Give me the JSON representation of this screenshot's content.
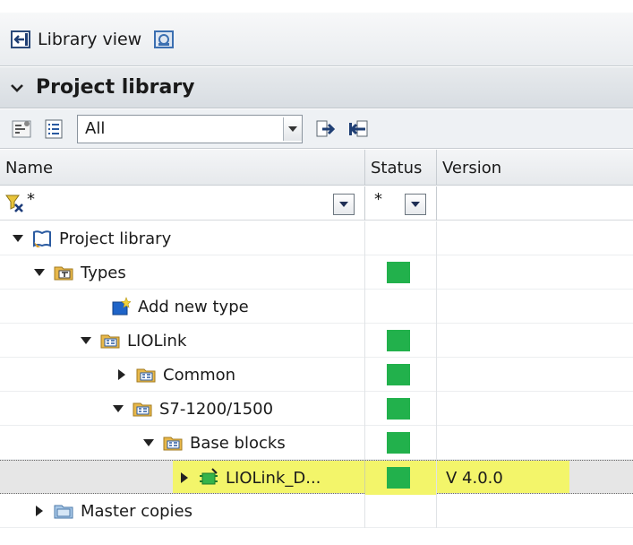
{
  "toolbar_top": {
    "library_view_label": "Library view"
  },
  "project_library": {
    "header_title": "Project library",
    "filter_value": "All"
  },
  "columns": {
    "name": "Name",
    "status": "Status",
    "version": "Version"
  },
  "filter_row": {
    "name_filter": "*",
    "status_filter": "*"
  },
  "tree": {
    "rows": [
      {
        "label": "Project library",
        "expanded": true,
        "status": null,
        "version": ""
      },
      {
        "label": "Types",
        "expanded": true,
        "status": "ok",
        "version": ""
      },
      {
        "label": "Add new type",
        "status": null,
        "version": ""
      },
      {
        "label": "LIOLink",
        "expanded": true,
        "status": "ok",
        "version": ""
      },
      {
        "label": "Common",
        "expanded": false,
        "status": "ok",
        "version": ""
      },
      {
        "label": "S7-1200/1500",
        "expanded": true,
        "status": "ok",
        "version": ""
      },
      {
        "label": "Base blocks",
        "expanded": true,
        "status": "ok",
        "version": ""
      },
      {
        "label": "LIOLink_D...",
        "expanded": false,
        "status": "ok",
        "version": "V 4.0.0",
        "selected": true
      },
      {
        "label": "Master copies",
        "expanded": false,
        "status": null,
        "version": ""
      }
    ]
  },
  "colors": {
    "status_ok": "#22b14c",
    "highlight": "#f3f56a",
    "folder": "#e8b84a"
  },
  "icons": [
    "library-view-icon",
    "library-help-icon",
    "expand-chevron-icon",
    "library-tree-icon",
    "list-view-icon",
    "dropdown-arrow-icon",
    "export-icon",
    "import-icon",
    "filter-clear-icon",
    "project-library-icon",
    "types-folder-icon",
    "add-type-icon",
    "group-folder-icon",
    "function-block-icon",
    "master-copies-folder-icon"
  ]
}
